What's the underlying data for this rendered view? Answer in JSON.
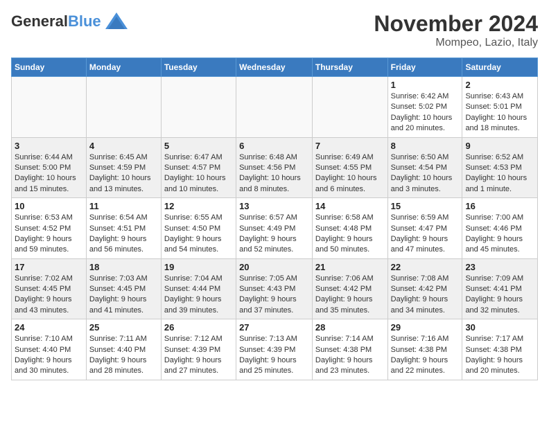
{
  "logo": {
    "general": "General",
    "blue": "Blue"
  },
  "header": {
    "month": "November 2024",
    "location": "Mompeo, Lazio, Italy"
  },
  "days_of_week": [
    "Sunday",
    "Monday",
    "Tuesday",
    "Wednesday",
    "Thursday",
    "Friday",
    "Saturday"
  ],
  "weeks": [
    [
      {
        "day": "",
        "info": ""
      },
      {
        "day": "",
        "info": ""
      },
      {
        "day": "",
        "info": ""
      },
      {
        "day": "",
        "info": ""
      },
      {
        "day": "",
        "info": ""
      },
      {
        "day": "1",
        "info": "Sunrise: 6:42 AM\nSunset: 5:02 PM\nDaylight: 10 hours and 20 minutes."
      },
      {
        "day": "2",
        "info": "Sunrise: 6:43 AM\nSunset: 5:01 PM\nDaylight: 10 hours and 18 minutes."
      }
    ],
    [
      {
        "day": "3",
        "info": "Sunrise: 6:44 AM\nSunset: 5:00 PM\nDaylight: 10 hours and 15 minutes."
      },
      {
        "day": "4",
        "info": "Sunrise: 6:45 AM\nSunset: 4:59 PM\nDaylight: 10 hours and 13 minutes."
      },
      {
        "day": "5",
        "info": "Sunrise: 6:47 AM\nSunset: 4:57 PM\nDaylight: 10 hours and 10 minutes."
      },
      {
        "day": "6",
        "info": "Sunrise: 6:48 AM\nSunset: 4:56 PM\nDaylight: 10 hours and 8 minutes."
      },
      {
        "day": "7",
        "info": "Sunrise: 6:49 AM\nSunset: 4:55 PM\nDaylight: 10 hours and 6 minutes."
      },
      {
        "day": "8",
        "info": "Sunrise: 6:50 AM\nSunset: 4:54 PM\nDaylight: 10 hours and 3 minutes."
      },
      {
        "day": "9",
        "info": "Sunrise: 6:52 AM\nSunset: 4:53 PM\nDaylight: 10 hours and 1 minute."
      }
    ],
    [
      {
        "day": "10",
        "info": "Sunrise: 6:53 AM\nSunset: 4:52 PM\nDaylight: 9 hours and 59 minutes."
      },
      {
        "day": "11",
        "info": "Sunrise: 6:54 AM\nSunset: 4:51 PM\nDaylight: 9 hours and 56 minutes."
      },
      {
        "day": "12",
        "info": "Sunrise: 6:55 AM\nSunset: 4:50 PM\nDaylight: 9 hours and 54 minutes."
      },
      {
        "day": "13",
        "info": "Sunrise: 6:57 AM\nSunset: 4:49 PM\nDaylight: 9 hours and 52 minutes."
      },
      {
        "day": "14",
        "info": "Sunrise: 6:58 AM\nSunset: 4:48 PM\nDaylight: 9 hours and 50 minutes."
      },
      {
        "day": "15",
        "info": "Sunrise: 6:59 AM\nSunset: 4:47 PM\nDaylight: 9 hours and 47 minutes."
      },
      {
        "day": "16",
        "info": "Sunrise: 7:00 AM\nSunset: 4:46 PM\nDaylight: 9 hours and 45 minutes."
      }
    ],
    [
      {
        "day": "17",
        "info": "Sunrise: 7:02 AM\nSunset: 4:45 PM\nDaylight: 9 hours and 43 minutes."
      },
      {
        "day": "18",
        "info": "Sunrise: 7:03 AM\nSunset: 4:45 PM\nDaylight: 9 hours and 41 minutes."
      },
      {
        "day": "19",
        "info": "Sunrise: 7:04 AM\nSunset: 4:44 PM\nDaylight: 9 hours and 39 minutes."
      },
      {
        "day": "20",
        "info": "Sunrise: 7:05 AM\nSunset: 4:43 PM\nDaylight: 9 hours and 37 minutes."
      },
      {
        "day": "21",
        "info": "Sunrise: 7:06 AM\nSunset: 4:42 PM\nDaylight: 9 hours and 35 minutes."
      },
      {
        "day": "22",
        "info": "Sunrise: 7:08 AM\nSunset: 4:42 PM\nDaylight: 9 hours and 34 minutes."
      },
      {
        "day": "23",
        "info": "Sunrise: 7:09 AM\nSunset: 4:41 PM\nDaylight: 9 hours and 32 minutes."
      }
    ],
    [
      {
        "day": "24",
        "info": "Sunrise: 7:10 AM\nSunset: 4:40 PM\nDaylight: 9 hours and 30 minutes."
      },
      {
        "day": "25",
        "info": "Sunrise: 7:11 AM\nSunset: 4:40 PM\nDaylight: 9 hours and 28 minutes."
      },
      {
        "day": "26",
        "info": "Sunrise: 7:12 AM\nSunset: 4:39 PM\nDaylight: 9 hours and 27 minutes."
      },
      {
        "day": "27",
        "info": "Sunrise: 7:13 AM\nSunset: 4:39 PM\nDaylight: 9 hours and 25 minutes."
      },
      {
        "day": "28",
        "info": "Sunrise: 7:14 AM\nSunset: 4:38 PM\nDaylight: 9 hours and 23 minutes."
      },
      {
        "day": "29",
        "info": "Sunrise: 7:16 AM\nSunset: 4:38 PM\nDaylight: 9 hours and 22 minutes."
      },
      {
        "day": "30",
        "info": "Sunrise: 7:17 AM\nSunset: 4:38 PM\nDaylight: 9 hours and 20 minutes."
      }
    ]
  ]
}
